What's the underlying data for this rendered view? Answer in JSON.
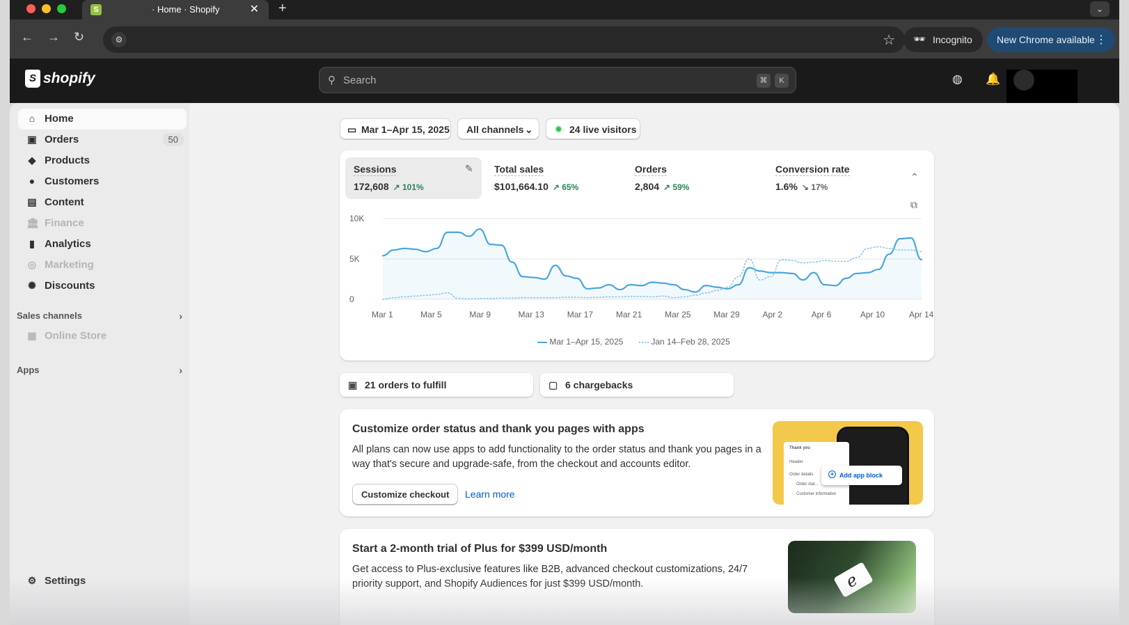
{
  "browser": {
    "tab_title": "· Home · Shopify",
    "new_tab": "+",
    "tab_close": "✕",
    "incognito_label": "Incognito",
    "update_label": "New Chrome available"
  },
  "topbar": {
    "logo_text": "shopify",
    "search_placeholder": "Search",
    "shortcut_cmd": "⌘",
    "shortcut_key": "K"
  },
  "sidebar": {
    "items": [
      {
        "label": "Home",
        "icon": "home-icon",
        "active": true
      },
      {
        "label": "Orders",
        "icon": "inbox-icon",
        "badge": "50"
      },
      {
        "label": "Products",
        "icon": "tag-icon"
      },
      {
        "label": "Customers",
        "icon": "person-icon"
      },
      {
        "label": "Content",
        "icon": "image-icon"
      },
      {
        "label": "Finance",
        "icon": "bank-icon",
        "disabled": true
      },
      {
        "label": "Analytics",
        "icon": "bar-chart-icon"
      },
      {
        "label": "Marketing",
        "icon": "target-icon",
        "disabled": true
      },
      {
        "label": "Discounts",
        "icon": "discount-icon"
      }
    ],
    "sales_channels_label": "Sales channels",
    "online_store_label": "Online Store",
    "apps_label": "Apps",
    "settings_label": "Settings"
  },
  "filters": {
    "date_range": "Mar 1–Apr 15, 2025",
    "channels": "All channels",
    "live_visitors": "24 live visitors"
  },
  "metrics": [
    {
      "name": "Sessions",
      "value": "172,608",
      "change": "101%",
      "direction": "up"
    },
    {
      "name": "Total sales",
      "value": "$101,664.10",
      "change": "65%",
      "direction": "up"
    },
    {
      "name": "Orders",
      "value": "2,804",
      "change": "59%",
      "direction": "up"
    },
    {
      "name": "Conversion rate",
      "value": "1.6%",
      "change": "17%",
      "direction": "down"
    }
  ],
  "chart_data": {
    "type": "line",
    "y_ticks": [
      "10K",
      "5K",
      "0"
    ],
    "ylim": [
      0,
      10000
    ],
    "x_ticks": [
      "Mar 1",
      "Mar 5",
      "Mar 9",
      "Mar 13",
      "Mar 17",
      "Mar 21",
      "Mar 25",
      "Mar 29",
      "Apr 2",
      "Apr 6",
      "Apr 10",
      "Apr 14"
    ],
    "grid": true,
    "legend_position": "bottom",
    "series": [
      {
        "name": "Mar 1–Apr 15, 2025",
        "style": "solid",
        "color": "#4aa6dc",
        "values": [
          5400,
          6100,
          6300,
          6200,
          5900,
          6300,
          8300,
          8300,
          7800,
          8700,
          6800,
          6700,
          4600,
          2800,
          2700,
          2500,
          4200,
          2900,
          2600,
          1300,
          1400,
          1800,
          1200,
          1800,
          1700,
          2100,
          2000,
          1800,
          1200,
          900,
          1700,
          1500,
          1300,
          1800,
          3900,
          3500,
          3300,
          3300,
          3200,
          2400,
          3300,
          1800,
          1700,
          2600,
          3200,
          3300,
          3700,
          5600,
          7500,
          7600,
          4900
        ]
      },
      {
        "name": "Jan 14–Feb 28, 2025",
        "style": "dotted",
        "color": "#8cc4e4",
        "values": [
          0,
          200,
          300,
          400,
          500,
          600,
          800,
          100,
          50,
          100,
          100,
          150,
          150,
          200,
          200,
          200,
          200,
          250,
          250,
          200,
          250,
          300,
          300,
          350,
          350,
          300,
          400,
          200,
          300,
          500,
          800,
          1100,
          1500,
          2800,
          5000,
          2400,
          2800,
          4900,
          4800,
          4500,
          4600,
          4800,
          4700,
          4700,
          5200,
          6300,
          6500,
          6300,
          6100,
          6100,
          5900
        ]
      }
    ]
  },
  "tasks": [
    {
      "label": "21 orders to fulfill",
      "icon": "inbox-icon"
    },
    {
      "label": "6 chargebacks",
      "icon": "clipboard-icon"
    }
  ],
  "promo1": {
    "title": "Customize order status and thank you pages with apps",
    "body": "All plans can now use apps to add functionality to the order status and thank you pages in a way that's secure and upgrade-safe, from the checkout and accounts editor.",
    "button": "Customize checkout",
    "link": "Learn more",
    "illus": {
      "sheet_title": "Thank you",
      "row1": "Header",
      "row2": "Order details",
      "row3": "Order stat...",
      "row4": "Customer information",
      "add_block": "Add app block"
    }
  },
  "promo2": {
    "title": "Start a 2-month trial of Plus for $399 USD/month",
    "body": "Get access to Plus-exclusive features like B2B, advanced checkout customizations, 24/7 priority support, and Shopify Audiences for just $399 USD/month."
  }
}
